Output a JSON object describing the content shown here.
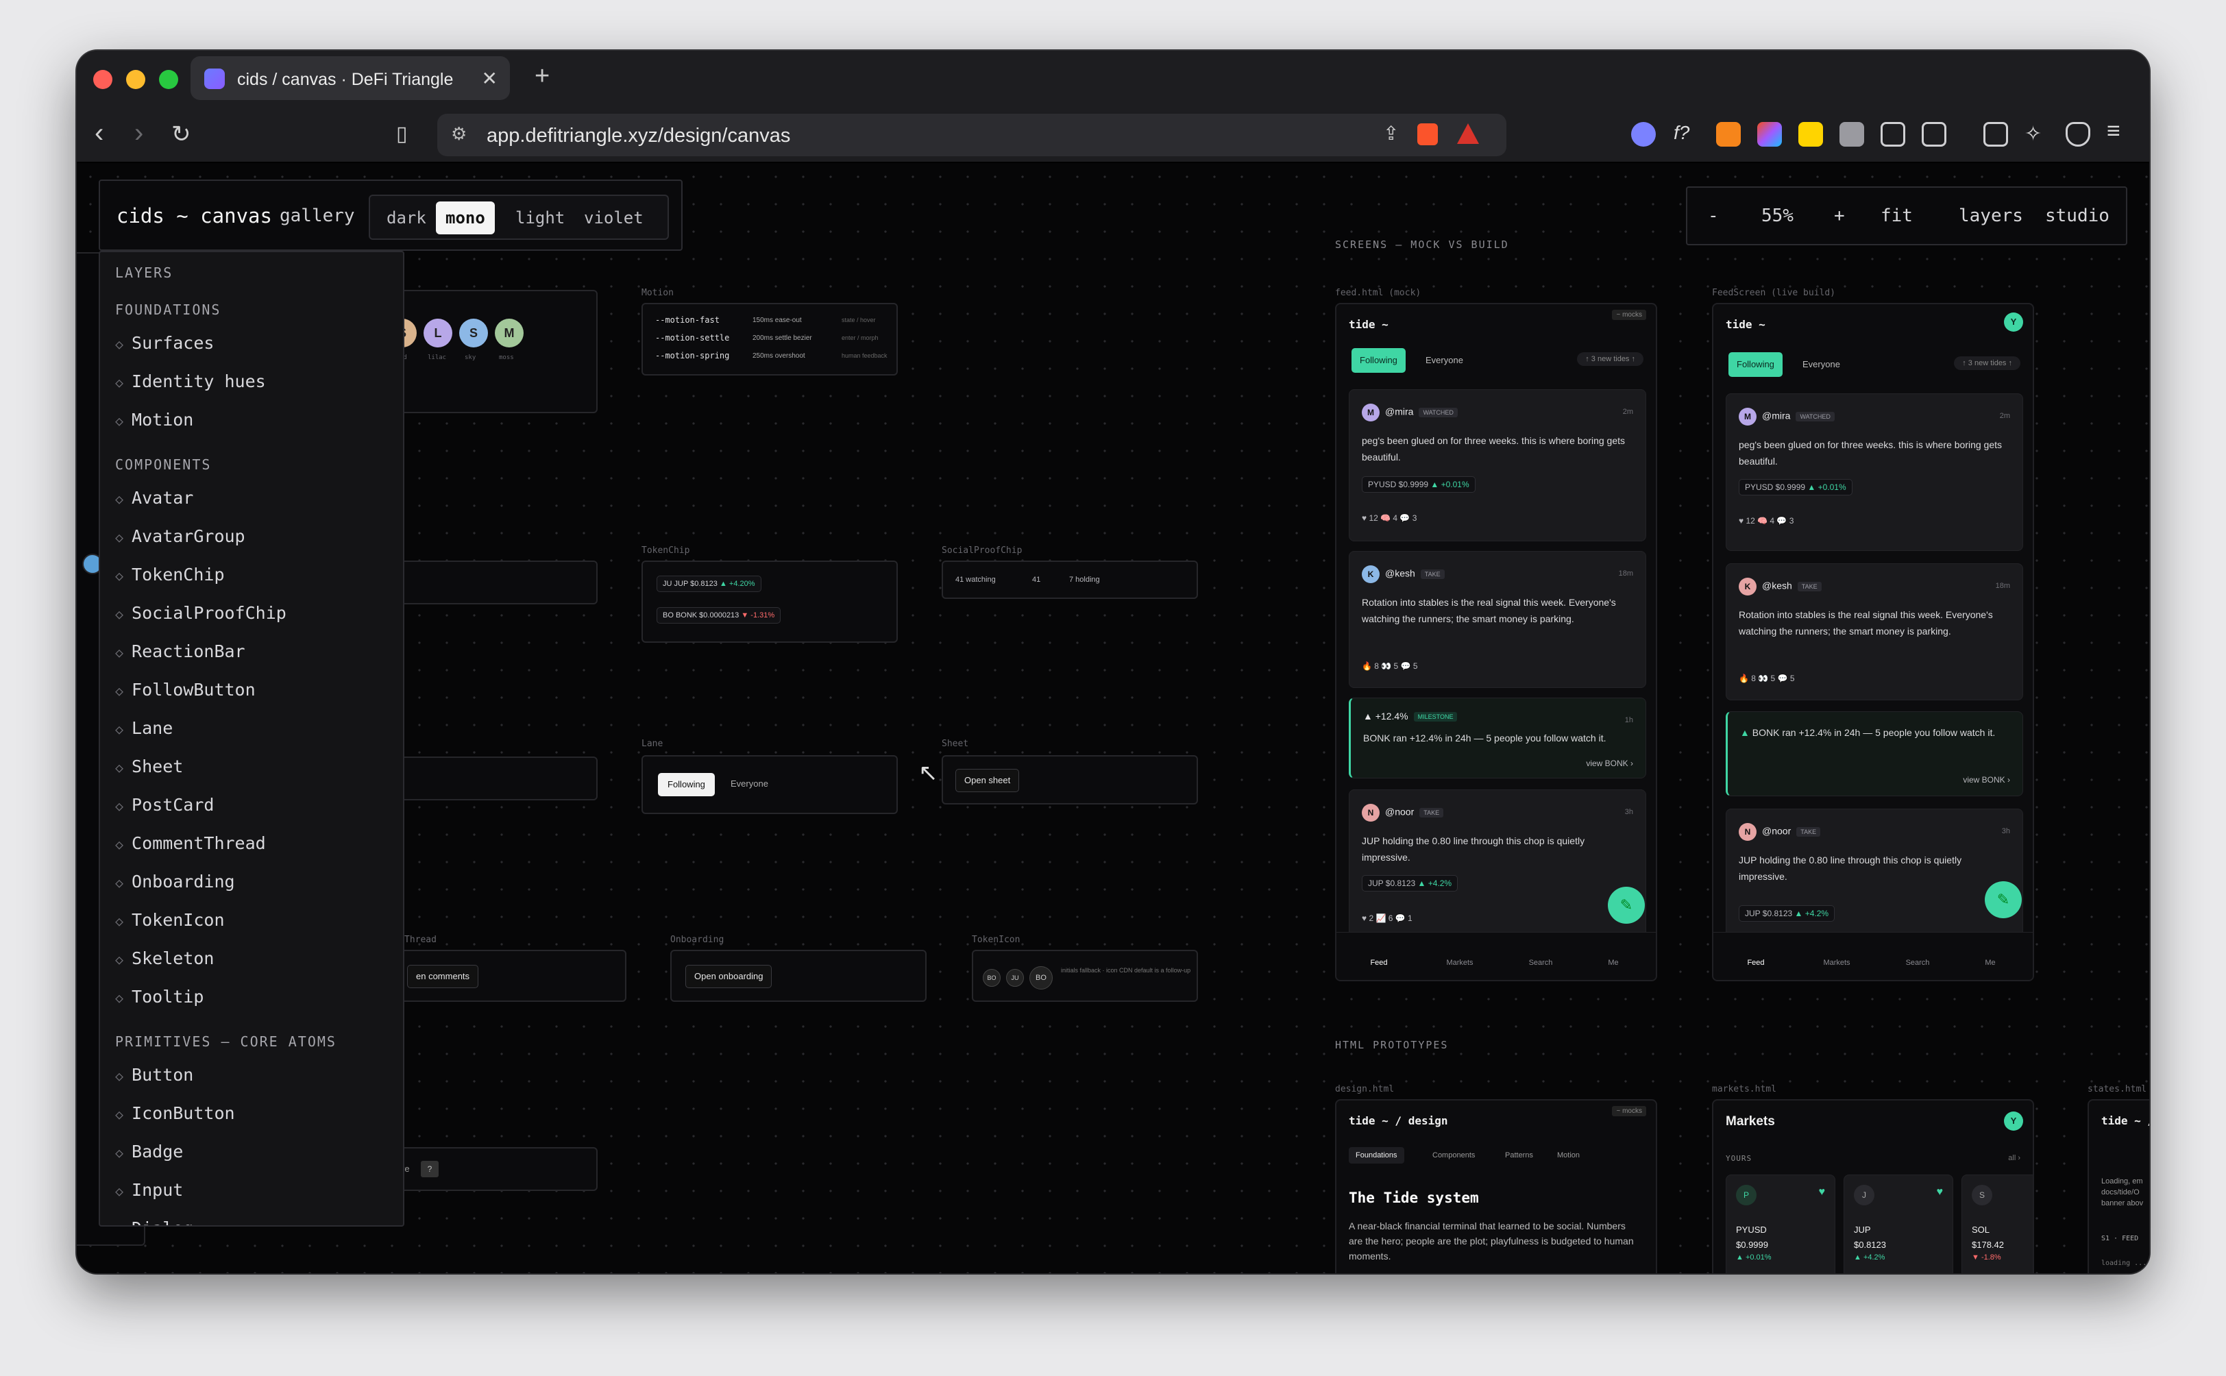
{
  "browser": {
    "tab_title": "cids / canvas · DeFi Triangle",
    "url": "app.defitriangle.xyz/design/canvas",
    "new_tab": "+",
    "close": "✕"
  },
  "topbar": {
    "brand": "cids ~ canvas",
    "gallery": "gallery",
    "themes": [
      "dark",
      "mono",
      "light",
      "violet"
    ],
    "active_theme": "mono"
  },
  "zoom": {
    "minus": "-",
    "level": "55%",
    "plus": "+",
    "fit": "fit",
    "layers": "layers",
    "studio": "studio"
  },
  "layers": {
    "title": "LAYERS",
    "foundations_label": "FOUNDATIONS",
    "foundations": [
      "Surfaces",
      "Identity hues",
      "Motion"
    ],
    "components_label": "COMPONENTS",
    "components": [
      "Avatar",
      "AvatarGroup",
      "TokenChip",
      "SocialProofChip",
      "ReactionBar",
      "FollowButton",
      "Lane",
      "Sheet",
      "PostCard",
      "CommentThread",
      "Onboarding",
      "TokenIcon",
      "Skeleton",
      "Tooltip"
    ],
    "primitives_label": "PRIMITIVES — CORE ATOMS",
    "primitives": [
      "Button",
      "IconButton",
      "Badge",
      "Input",
      "Dialog"
    ]
  },
  "canvas": {
    "motion": {
      "label": "Motion",
      "rows": [
        {
          "name": "--motion-fast",
          "value": "150ms ease-out",
          "use": "state / hover"
        },
        {
          "name": "--motion-settle",
          "value": "200ms settle bezier",
          "use": "enter / morph"
        },
        {
          "name": "--motion-spring",
          "value": "250ms overshoot",
          "use": "human feedback"
        }
      ]
    },
    "hues": [
      "S",
      "L",
      "S",
      "M"
    ],
    "hue_names": [
      "sand",
      "lilac",
      "sky",
      "moss"
    ],
    "tokenchip": {
      "label": "TokenChip",
      "a": "JU JUP $0.8123",
      "a_delta": "▲ +4.20%",
      "b": "BO BONK $0.0000213",
      "b_delta": "▼ -1.31%"
    },
    "socialproof": {
      "label": "SocialProofChip",
      "a": "41 watching",
      "b": "41",
      "c": "7 holding"
    },
    "lane": {
      "label": "Lane",
      "a": "Following",
      "b": "Everyone"
    },
    "sheet": {
      "label": "Sheet",
      "button": "Open sheet"
    },
    "commentthread": {
      "label": "Thread",
      "button": "en comments"
    },
    "onboarding": {
      "label": "Onboarding",
      "button": "Open onboarding"
    },
    "tokenicon": {
      "label": "TokenIcon",
      "icons": [
        "BO",
        "JU",
        "BO"
      ],
      "note": "initials fallback · icon CDN default is a follow-up"
    },
    "tooltip": {
      "text": "re",
      "key": "?"
    }
  },
  "screens": {
    "title": "SCREENS — MOCK VS BUILD",
    "mock_label": "feed.html (mock)",
    "build_label": "FeedScreen (live build)",
    "app_title": "tide ~",
    "mock_badge": "~ mocks",
    "lanes": [
      "Following",
      "Everyone"
    ],
    "new_tides": "↑ 3 new tides ↑",
    "posts": [
      {
        "user": "@mira",
        "tag": "WATCHED",
        "time": "2m",
        "body": "peg's been glued on for three weeks. this is where boring gets beautiful.",
        "token": "PYUSD $0.9999",
        "delta": "▲ +0.01%",
        "reactions": "♥ 12   🧠 4   💬 3"
      },
      {
        "user": "@kesh",
        "tag": "TAKE",
        "time": "18m",
        "body": "Rotation into stables is the real signal this week. Everyone's watching the runners; the smart money is parking.",
        "reactions": "🔥 8   👀 5   💬 5"
      },
      {
        "milestone": "▲ +12.4%",
        "tag": "MILESTONE",
        "time": "1h",
        "body": "BONK ran +12.4% in 24h — 5 people you follow watch it.",
        "link": "view BONK ›"
      },
      {
        "user": "@noor",
        "tag": "TAKE",
        "time": "3h",
        "body": "JUP holding the 0.80 line through this chop is quietly impressive.",
        "token": "JUP $0.8123",
        "delta": "▲ +4.2%",
        "reactions": "♥ 2   📈 6   💬 1"
      }
    ],
    "nav": [
      "Feed",
      "Markets",
      "Search",
      "Me"
    ]
  },
  "prototypes": {
    "title": "HTML PROTOTYPES",
    "design_label": "design.html",
    "design_title": "tide ~ / design",
    "design_tabs": [
      "Foundations",
      "Components",
      "Patterns",
      "Motion"
    ],
    "design_heading": "The Tide system",
    "design_body": "A near-black financial terminal that learned to be social. Numbers are the hero; people are the plot; playfulness is budgeted to human moments.",
    "markets_label": "markets.html",
    "markets_title": "Markets",
    "markets_sub": "YOURS",
    "markets_all": "all ›",
    "markets": [
      {
        "sym": "PYUSD",
        "price": "$0.9999",
        "delta": "▲ +0.01%"
      },
      {
        "sym": "JUP",
        "price": "$0.8123",
        "delta": "▲ +4.2%"
      },
      {
        "sym": "SOL",
        "price": "$178.42",
        "delta": "▼ -1.8%"
      }
    ],
    "states_label": "states.html",
    "states_title": "tide ~ /",
    "states_body": "Loading, em docs/tide/O banner abov",
    "states_feed": "S1 · FEED",
    "states_loading": "loading ..."
  }
}
